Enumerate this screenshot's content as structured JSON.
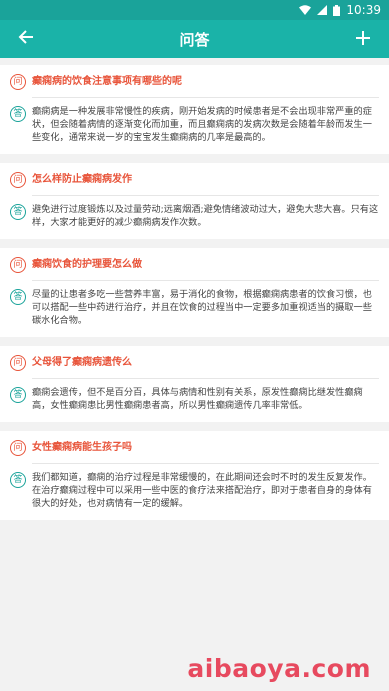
{
  "status_bar": {
    "time": "10:39",
    "wifi_icon": "wifi-icon",
    "signal_icon": "signal-icon",
    "battery_icon": "battery-icon"
  },
  "app_bar": {
    "title": "问答",
    "back_icon": "back-arrow-icon",
    "add_icon": "plus-icon"
  },
  "labels": {
    "question_badge": "问",
    "answer_badge": "答"
  },
  "colors": {
    "primary": "#1ab3a8",
    "status": "#1aa39a",
    "question": "#e8543a",
    "answer_badge": "#1aa39a",
    "watermark": "#e74a5f"
  },
  "items": [
    {
      "question": "癫痫病的饮食注意事项有哪些的呢",
      "answer": "癫痫病是一种发展非常慢性的疾病，刚开始发病的时候患者是不会出现非常严重的症状，但会随着病情的逐渐变化而加重，而且癫痫病的发病次数是会随着年龄而发生一些变化，通常来说一岁的宝宝发生癫痫病的几率是最高的。"
    },
    {
      "question": "怎么样防止癫痫病发作",
      "answer": "避免进行过度锻炼以及过量劳动;远离烟酒;避免情绪波动过大，避免大悲大喜。只有这样，大家才能更好的减少癫痫病发作次数。"
    },
    {
      "question": "癫痫饮食的护理要怎么做",
      "answer": "尽量的让患者多吃一些营养丰富，易于消化的食物，根据癫痫病患者的饮食习惯，也可以搭配一些中药进行治疗，并且在饮食的过程当中一定要多加重视适当的摄取一些碳水化合物。"
    },
    {
      "question": "父母得了癫痫病遗传么",
      "answer": "癫痫会遗传，但不是百分百，具体与病情和性别有关系，原发性癫痫比继发性癫痫高，女性癫痫患比男性癫痫患者高，所以男性癫痫遗传几率非常低。"
    },
    {
      "question": "女性癫痫病能生孩子吗",
      "answer": "我们都知道，癫痫的治疗过程是非常缓慢的，在此期间还会时不时的发生反复发作。在治疗癫痫过程中可以采用一些中医的食疗法来搭配治疗，即对于患者自身的身体有很大的好处，也对病情有一定的缓解。"
    }
  ],
  "watermark": "aibaoya.com"
}
